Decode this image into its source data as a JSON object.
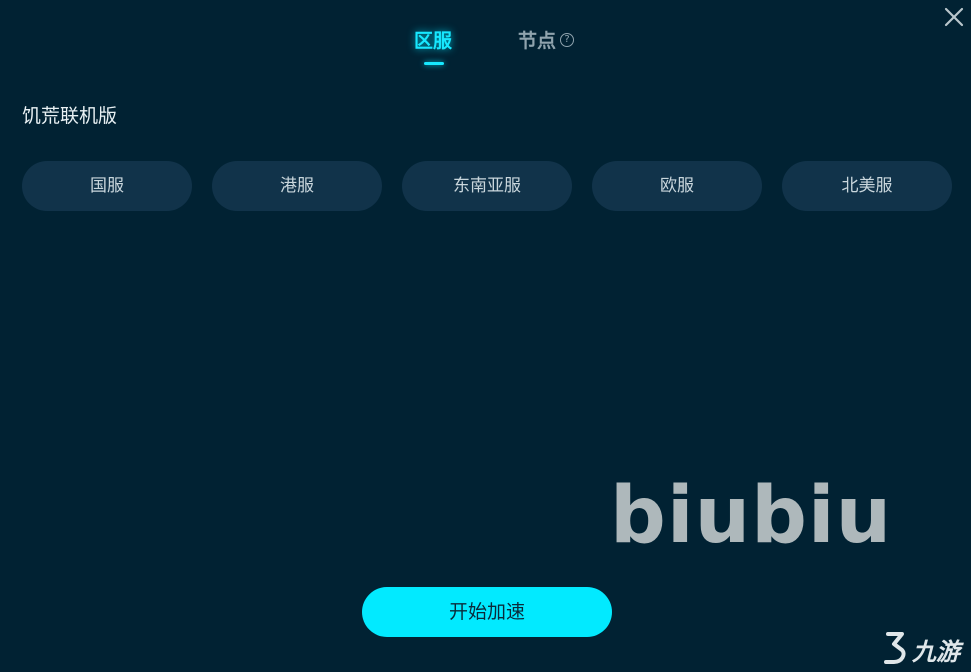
{
  "tabs": {
    "region": "区服",
    "node": "节点",
    "help_symbol": "?"
  },
  "game": {
    "title": "饥荒联机版"
  },
  "servers": [
    "国服",
    "港服",
    "东南亚服",
    "欧服",
    "北美服"
  ],
  "actions": {
    "start": "开始加速"
  },
  "watermark": {
    "text": "biubiu"
  },
  "corner_logo": {
    "text": "九游"
  },
  "colors": {
    "background": "#012233",
    "accent": "#17e8ff",
    "pill": "#11334a",
    "start_button": "#02eaff"
  }
}
